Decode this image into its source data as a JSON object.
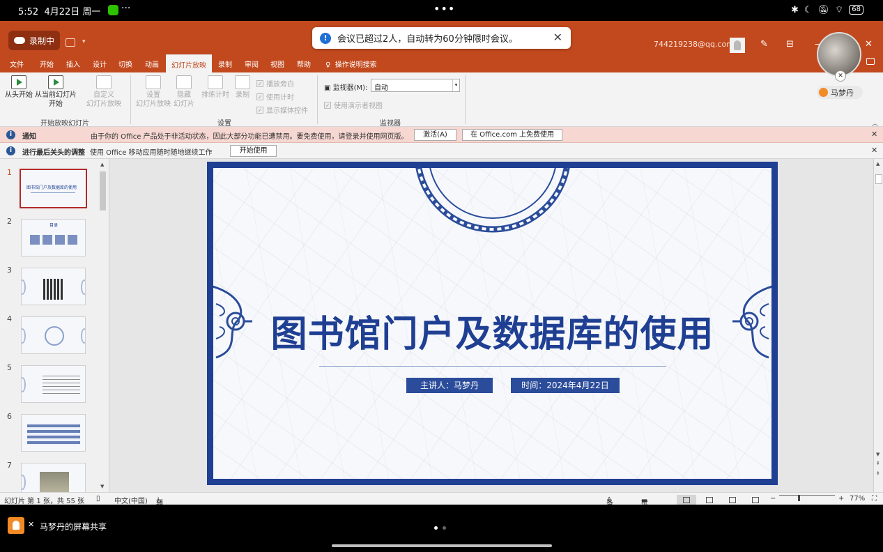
{
  "status_bar": {
    "time": "5:52",
    "date": "4月22日 周一",
    "more": "···",
    "center_more": "•••",
    "icons": [
      "bluetooth-icon",
      "moon-icon",
      "mute-icon",
      "wifi-icon"
    ],
    "battery": "68"
  },
  "recording": {
    "label": "录制中"
  },
  "toast": {
    "message": "会议已超过2人，自动转为60分钟限时会议。"
  },
  "account": {
    "email": "744219238@qq.com"
  },
  "participant": {
    "name": "马梦丹"
  },
  "tabs": [
    "文件",
    "开始",
    "插入",
    "设计",
    "切换",
    "动画",
    "幻灯片放映",
    "录制",
    "审阅",
    "视图",
    "帮助"
  ],
  "active_tab": "幻灯片放映",
  "tell_me": "操作说明搜索",
  "ribbon": {
    "from_start": "从头开始",
    "from_current_1": "从当前幻灯片",
    "from_current_2": "开始",
    "custom_1": "自定义",
    "custom_2": "幻灯片放映",
    "group_start": "开始放映幻灯片",
    "setup_1": "设置",
    "setup_2": "幻灯片放映",
    "hide_1": "隐藏",
    "hide_2": "幻灯片",
    "rehearse": "排练计时",
    "record": "录制",
    "chk_narration": "播放旁白",
    "chk_timing": "使用计时",
    "chk_media": "显示媒体控件",
    "group_setup": "设置",
    "monitor_label": "监视器(M):",
    "monitor_value": "自动",
    "presenter_view": "使用演示者视图",
    "group_monitor": "监视器"
  },
  "notice": {
    "title": "通知",
    "text": "由于你的 Office 产品处于非活动状态，因此大部分功能已遭禁用。要免费使用，请登录并使用网页版。",
    "activate": "激活(A)",
    "free_use": "在 Office.com 上免费使用"
  },
  "notice2": {
    "title": "进行最后关头的调整",
    "text": "使用 Office 移动应用随时随地继续工作",
    "button": "开始使用"
  },
  "thumbnails": {
    "numbers": [
      "1",
      "2",
      "3",
      "4",
      "5",
      "6",
      "7"
    ],
    "slide1_title": "图书馆门户及数据库的使用",
    "slide2_title": "目录"
  },
  "slide": {
    "title": "图书馆门户及数据库的使用",
    "presenter": "主讲人：马梦丹",
    "date": "时间：2024年4月22日"
  },
  "status": {
    "slide_info": "幻灯片 第 1 张，共 55 张",
    "language": "中文(中国)",
    "accessibility": "辅助功能: 不可用",
    "notes": "备注",
    "comments": "批注",
    "zoom": "77%"
  },
  "meeting": {
    "share_label": "马梦丹的屏幕共享"
  },
  "colors": {
    "title_bar": "#c2491e",
    "slide_blue": "#1f3f93",
    "notice_bg": "#f6d7d2"
  }
}
